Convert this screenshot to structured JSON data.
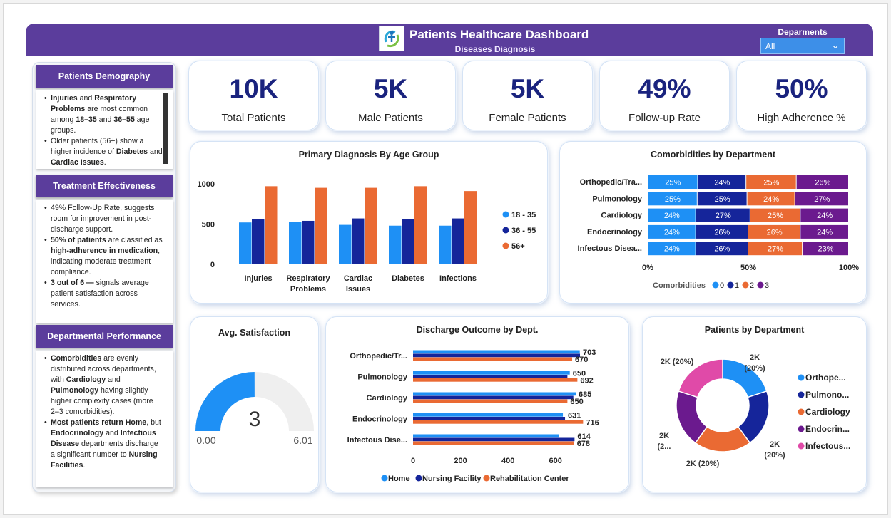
{
  "header": {
    "title": "Patients Healthcare Dashboard",
    "subtitle": "Diseases Diagnosis",
    "dept_filter_label": "Deparments",
    "dept_filter_value": "All"
  },
  "sidebar": {
    "demography_title": "Patients Demography",
    "treatment_title": "Treatment Effectiveness",
    "departmental_title": "Departmental Performance"
  },
  "kpis": [
    {
      "value": "10K",
      "label": "Total Patients"
    },
    {
      "value": "5K",
      "label": "Male Patients"
    },
    {
      "value": "5K",
      "label": "Female Patients"
    },
    {
      "value": "49%",
      "label": "Follow-up Rate"
    },
    {
      "value": "50%",
      "label": "High Adherence %"
    }
  ],
  "colors": {
    "c0": "#1e90f5",
    "c1": "#15259a",
    "c2": "#ea6a33",
    "c3": "#6b1a8e",
    "c4": "#e04aa8",
    "header": "#5b3d9c",
    "gauge_track": "#efefef"
  },
  "chart_data": [
    {
      "type": "bar",
      "title": "Primary Diagnosis By Age Group",
      "categories": [
        "Injuries",
        "Respiratory Problems",
        "Cardiac Issues",
        "Diabetes",
        "Infections"
      ],
      "category_lines": [
        [
          "Injuries"
        ],
        [
          "Respiratory",
          "Problems"
        ],
        [
          "Cardiac",
          "Issues"
        ],
        [
          "Diabetes"
        ],
        [
          "Infections"
        ]
      ],
      "series": [
        {
          "name": "18 - 35",
          "values": [
            520,
            530,
            490,
            480,
            480
          ]
        },
        {
          "name": "36 - 55",
          "values": [
            560,
            540,
            570,
            560,
            570
          ]
        },
        {
          "name": "56+",
          "values": [
            970,
            950,
            950,
            970,
            910
          ]
        }
      ],
      "ylim": [
        0,
        1150
      ],
      "yticks": [
        0,
        500,
        1000
      ],
      "legend": "right"
    },
    {
      "type": "bar",
      "orientation": "horizontal",
      "stacked": "percent",
      "title": "Comorbidities by Department",
      "categories": [
        "Orthopedic/Tra...",
        "Pulmonology",
        "Cardiology",
        "Endocrinology",
        "Infectous Disea..."
      ],
      "series": [
        {
          "name": "0",
          "values": [
            25,
            25,
            24,
            24,
            24
          ]
        },
        {
          "name": "1",
          "values": [
            24,
            25,
            27,
            26,
            26
          ]
        },
        {
          "name": "2",
          "values": [
            25,
            24,
            25,
            26,
            27
          ]
        },
        {
          "name": "3",
          "values": [
            26,
            27,
            24,
            24,
            23
          ]
        }
      ],
      "xticks": [
        "0%",
        "50%",
        "100%"
      ],
      "legend_title": "Comorbidities",
      "legend": "bottom"
    },
    {
      "type": "gauge",
      "title": "Avg. Satisfaction",
      "value": 3,
      "min": 0,
      "max": 6.01,
      "value_label": "3",
      "min_label": "0.00",
      "max_label": "6.01"
    },
    {
      "type": "bar",
      "orientation": "horizontal",
      "title": "Discharge Outcome by Dept.",
      "categories": [
        "Orthopedic/Tr...",
        "Pulmonology",
        "Cardiology",
        "Endocrinology",
        "Infectous Dise..."
      ],
      "series": [
        {
          "name": "Home",
          "values": [
            702,
            660,
            685,
            631,
            614
          ]
        },
        {
          "name": "Nursing Facility",
          "values": [
            703,
            650,
            675,
            640,
            680
          ]
        },
        {
          "name": "Rehabilitation Center",
          "values": [
            670,
            692,
            650,
            716,
            678
          ]
        }
      ],
      "value_labels": [
        [
          "703",
          "670"
        ],
        [
          "650",
          "692"
        ],
        [
          "685",
          "650"
        ],
        [
          "631",
          "716"
        ],
        [
          "614",
          "678"
        ]
      ],
      "xlim": [
        0,
        760
      ],
      "xticks": [
        0,
        200,
        400,
        600
      ],
      "legend": "bottom"
    },
    {
      "type": "pie",
      "donut": true,
      "title": "Patients by Department",
      "categories": [
        "Orthope...",
        "Pulmono...",
        "Cardiology",
        "Endocrin...",
        "Infectous..."
      ],
      "values": [
        20,
        20,
        20,
        20,
        20
      ],
      "labels": [
        [
          "2K",
          "(20%)"
        ],
        [
          "2K",
          "(20%)"
        ],
        [
          "2K (20%)"
        ],
        [
          "2K",
          "(2..."
        ],
        [
          "2K (20%)"
        ]
      ],
      "legend": "right"
    }
  ]
}
